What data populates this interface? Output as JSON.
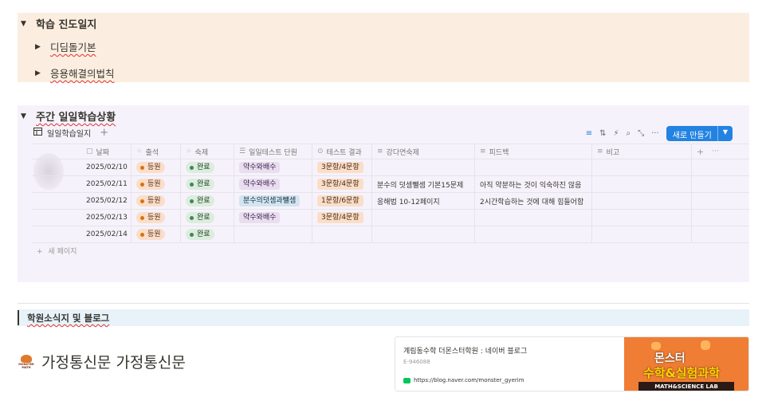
{
  "section_progress": {
    "title": "학습 진도일지",
    "items": [
      "디딤돌기본",
      "응용해결의법칙"
    ]
  },
  "section_weekly": {
    "title": "주간 일일학습상황",
    "db_view_label": "일일학습일지",
    "new_button_label": "새로 만들기",
    "new_page_label": "새 페이지",
    "columns": [
      "날짜",
      "출석",
      "숙제",
      "일일테스트 단원",
      "테스트 결과",
      "강다연숙제",
      "피드백",
      "비고"
    ],
    "rows": [
      {
        "date": "2025/02/10",
        "attendance": "등원",
        "homework": "완료",
        "unit": "약수와배수",
        "result": "3문항/4문항",
        "assignment": "",
        "feedback": ""
      },
      {
        "date": "2025/02/11",
        "attendance": "등원",
        "homework": "완료",
        "unit": "약수와배수",
        "result": "3문항/4문항",
        "assignment": "분수의 덧셈뺄셈 기본15문제",
        "feedback": "아직 약분하는 것이 익숙하진 않음"
      },
      {
        "date": "2025/02/12",
        "attendance": "등원",
        "homework": "완료",
        "unit": "분수의덧셈과뺄셈",
        "result": "1문항/6문항",
        "assignment": "응해법 10-12페이지",
        "feedback": "2시간학습하는 것에 대해 힘들어함"
      },
      {
        "date": "2025/02/13",
        "attendance": "등원",
        "homework": "완료",
        "unit": "약수와배수",
        "result": "3문항/4문항",
        "assignment": "",
        "feedback": ""
      },
      {
        "date": "2025/02/14",
        "attendance": "등원",
        "homework": "완료",
        "unit": "",
        "result": "",
        "assignment": "",
        "feedback": ""
      }
    ]
  },
  "section_news": {
    "title": "학원소식지 및 블로그"
  },
  "letter": {
    "logo_text": "MONSTER MATH",
    "title": "가정통신문 가정통신문"
  },
  "blog_card": {
    "title": "계림동수학 더몬스터학원 : 네이버 블로그",
    "description": "E-946088",
    "url": "https://blog.naver.com/monster_gyerim",
    "thumb_line1": "몬스터",
    "thumb_line2": "수학&실험과학",
    "thumb_band": "MATH&SCIENCE LAB"
  },
  "colors": {
    "progress_bg": "#fbeee0",
    "weekly_bg": "#f6f2fb",
    "news_bg": "#e7f3f8",
    "accent": "#2383e2"
  }
}
